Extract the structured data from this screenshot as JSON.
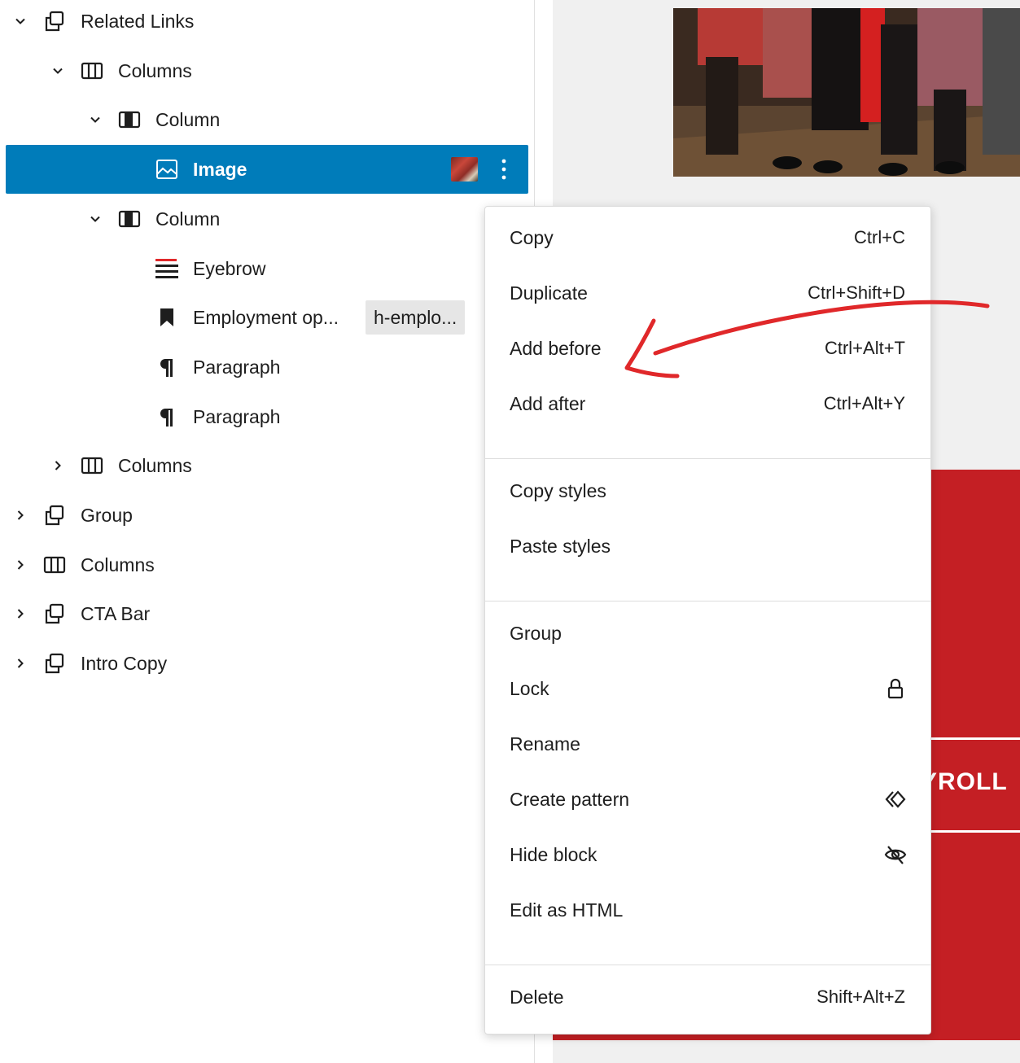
{
  "list_view": {
    "items": [
      {
        "label": "Related Links",
        "chevron": "chevron-down-icon",
        "icon": "group-icon"
      },
      {
        "label": "Columns",
        "chevron": "chevron-down-icon",
        "icon": "columns-icon"
      },
      {
        "label": "Column",
        "chevron": "chevron-down-icon",
        "icon": "column-icon"
      },
      {
        "label": "Image",
        "chevron": "",
        "icon": "image-icon",
        "selected": true
      },
      {
        "label": "Column",
        "chevron": "chevron-down-icon",
        "icon": "column-icon"
      },
      {
        "label": "Eyebrow",
        "chevron": "",
        "icon": "eyebrow-icon"
      },
      {
        "label": "Employment op...",
        "chevron": "",
        "icon": "bookmark-icon",
        "anchor": "h-emplo..."
      },
      {
        "label": "Paragraph",
        "chevron": "",
        "icon": "paragraph-icon"
      },
      {
        "label": "Paragraph",
        "chevron": "",
        "icon": "paragraph-icon"
      },
      {
        "label": "Columns",
        "chevron": "chevron-right-icon",
        "icon": "columns-icon"
      },
      {
        "label": "Group",
        "chevron": "chevron-right-icon",
        "icon": "group-icon"
      },
      {
        "label": "Columns",
        "chevron": "chevron-right-icon",
        "icon": "columns-icon"
      },
      {
        "label": "CTA Bar",
        "chevron": "chevron-right-icon",
        "icon": "group-icon"
      },
      {
        "label": "Intro Copy",
        "chevron": "chevron-right-icon",
        "icon": "group-icon"
      }
    ],
    "selected_color": "#007cba"
  },
  "context_menu": {
    "sections": [
      [
        {
          "label": "Copy",
          "shortcut": "Ctrl+C"
        },
        {
          "label": "Duplicate",
          "shortcut": "Ctrl+Shift+D"
        },
        {
          "label": "Add before",
          "shortcut": "Ctrl+Alt+T"
        },
        {
          "label": "Add after",
          "shortcut": "Ctrl+Alt+Y"
        }
      ],
      [
        {
          "label": "Copy styles"
        },
        {
          "label": "Paste styles"
        }
      ],
      [
        {
          "label": "Group"
        },
        {
          "label": "Lock",
          "icon": "lock-icon"
        },
        {
          "label": "Rename"
        },
        {
          "label": "Create pattern",
          "icon": "pattern-icon"
        },
        {
          "label": "Hide block",
          "icon": "hide-icon"
        },
        {
          "label": "Edit as HTML"
        }
      ],
      [
        {
          "label": "Delete",
          "shortcut": "Shift+Alt+Z"
        }
      ]
    ]
  },
  "canvas": {
    "partial_heading": "YROLL",
    "section_color": "#c41f24"
  },
  "annotation": {
    "arrow_color": "#e0282a"
  }
}
